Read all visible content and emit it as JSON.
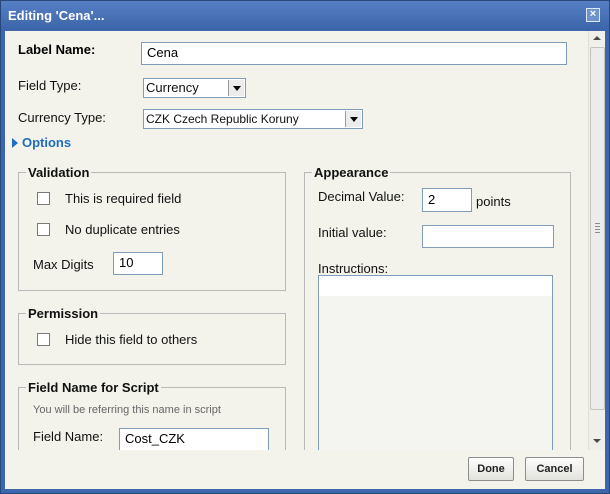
{
  "dialog": {
    "title": "Editing 'Cena'...",
    "close_icon": "close-icon"
  },
  "label_name": {
    "label": "Label Name:",
    "value": "Cena"
  },
  "field_type": {
    "label": "Field Type:",
    "selected": "Currency"
  },
  "currency_type": {
    "label": "Currency Type:",
    "selected": "CZK Czech Republic Koruny"
  },
  "options": {
    "label": "Options"
  },
  "validation": {
    "legend": "Validation",
    "required_label": "This is required field",
    "no_duplicates_label": "No duplicate entries",
    "max_digits_label": "Max Digits",
    "max_digits_value": "10"
  },
  "permission": {
    "legend": "Permission",
    "hide_label": "Hide this field to others"
  },
  "field_script": {
    "legend": "Field Name for Script",
    "hint": "You will be referring this name in script",
    "field_name_label": "Field Name:",
    "field_name_value": "Cost_CZK"
  },
  "appearance": {
    "legend": "Appearance",
    "decimal_label": "Decimal Value:",
    "decimal_value": "2",
    "decimal_unit": "points",
    "initial_label": "Initial value:",
    "initial_value": "",
    "instructions_label": "Instructions:",
    "instructions_value": ""
  },
  "buttons": {
    "done": "Done",
    "cancel": "Cancel"
  },
  "colors": {
    "titlebar": "#3d67ad",
    "panel_bg": "#f3f3eb",
    "link": "#1f6dbf"
  }
}
